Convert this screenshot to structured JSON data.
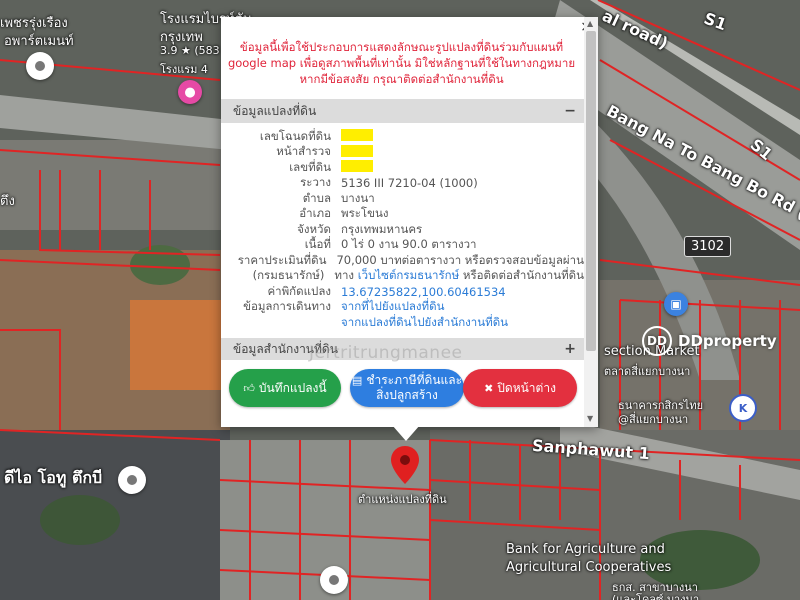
{
  "map": {
    "labels": {
      "hotel_th_1": "โรงแรมไบรท์ตัน",
      "hotel_th_2": "กรุงเทพ",
      "hotel_rating": "3.9 ★ (583",
      "hotel_type": "โรงแรม 4",
      "building_th_1": "เพชรรุ่งเรือง",
      "building_th_2": "อพาร์ตเมนท์",
      "road_s1_top": "S1",
      "road_name": "Bang Na To Bang Bo Rd (Toll",
      "road_local": "al road)",
      "road_s1_right": "S1",
      "route_number": "3102",
      "market_en": "section Market",
      "market_th": "ตลาดสี่แยกบางนา",
      "bank_th_1": "ธนาคารกสิกรไทย",
      "bank_th_2": "@สี่แยกบางนา",
      "street": "Sanphawut 1",
      "idea_o2": "ดีไอ โอทู ตึกบี",
      "parcel_location": "ตำแหน่งแปลงที่ดิน",
      "baac_1": "Bank for Agriculture and",
      "baac_2": "Agricultural Cooperatives",
      "baac_th": "ธกส. สาขาบางนา",
      "baac_th_2": "(และโคลซ์ บางนา",
      "side_left": "ตึง"
    },
    "markers": {
      "hotel_icon": "bed-icon",
      "shop_icon": "cart-icon",
      "bank_icon": "bank-icon",
      "pin_color": "#e02020"
    }
  },
  "popup": {
    "close_label": "×",
    "notice": "ข้อมูลนี้เพื่อใช้ประกอบการแสดงลักษณะรูปแปลงที่ดินร่วมกับแผนที่ google map เพื่อดูสภาพพื้นที่เท่านั้น มิใช่หลักฐานที่ใช้ในทางกฎหมาย หากมีข้อสงสัย กรุณาติดต่อสำนักงานที่ดิน",
    "section1": {
      "title": "ข้อมูลแปลงที่ดิน",
      "toggle": "−"
    },
    "fields": [
      {
        "label": "เลขโฉนดที่ดิน",
        "value": "",
        "highlight": true
      },
      {
        "label": "หน้าสำรวจ",
        "value": "",
        "highlight": true
      },
      {
        "label": "เลขที่ดิน",
        "value": "",
        "highlight": true
      },
      {
        "label": "ระวาง",
        "value": "5136 III 7210-04 (1000)"
      },
      {
        "label": "ตำบล",
        "value": "บางนา"
      },
      {
        "label": "อำเภอ",
        "value": "พระโขนง"
      },
      {
        "label": "จังหวัด",
        "value": "กรุงเทพมหานคร"
      },
      {
        "label": "เนื้อที่",
        "value": "0 ไร่ 0 งาน 90.0 ตารางวา"
      },
      {
        "label": "ราคาประเมินที่ดิน",
        "value": "70,000 บาทต่อตารางวา หรือตรวจสอบข้อมูลผ่าน"
      },
      {
        "label": "(กรมธนารักษ์)",
        "value_pre": "ทาง ",
        "value_link": "เว็บไซต์กรมธนารักษ์",
        "value_post": " หรือติดต่อสำนักงานที่ดิน"
      },
      {
        "label": "ค่าพิกัดแปลง",
        "value_link": "13.67235822,100.60461534"
      },
      {
        "label": "ข้อมูลการเดินทาง",
        "value_link": "จากที่ไปยังแปลงที่ดิน"
      },
      {
        "label": "",
        "value_link": "จากแปลงที่ดินไปยังสำนักงานที่ดิน"
      }
    ],
    "section2": {
      "title": "ข้อมูลสำนักงานที่ดิน",
      "toggle": "+"
    },
    "watermark": "Jertritrungmanee",
    "buttons": {
      "save": "บันทึกแปลงนี้",
      "tax_1": "ชำระภาษีที่ดินและ",
      "tax_2": "สิ่งปลูกสร้าง",
      "close": "ปิดหน้าต่าง"
    }
  },
  "brand": {
    "name": "DDproperty",
    "logo": "DD"
  }
}
